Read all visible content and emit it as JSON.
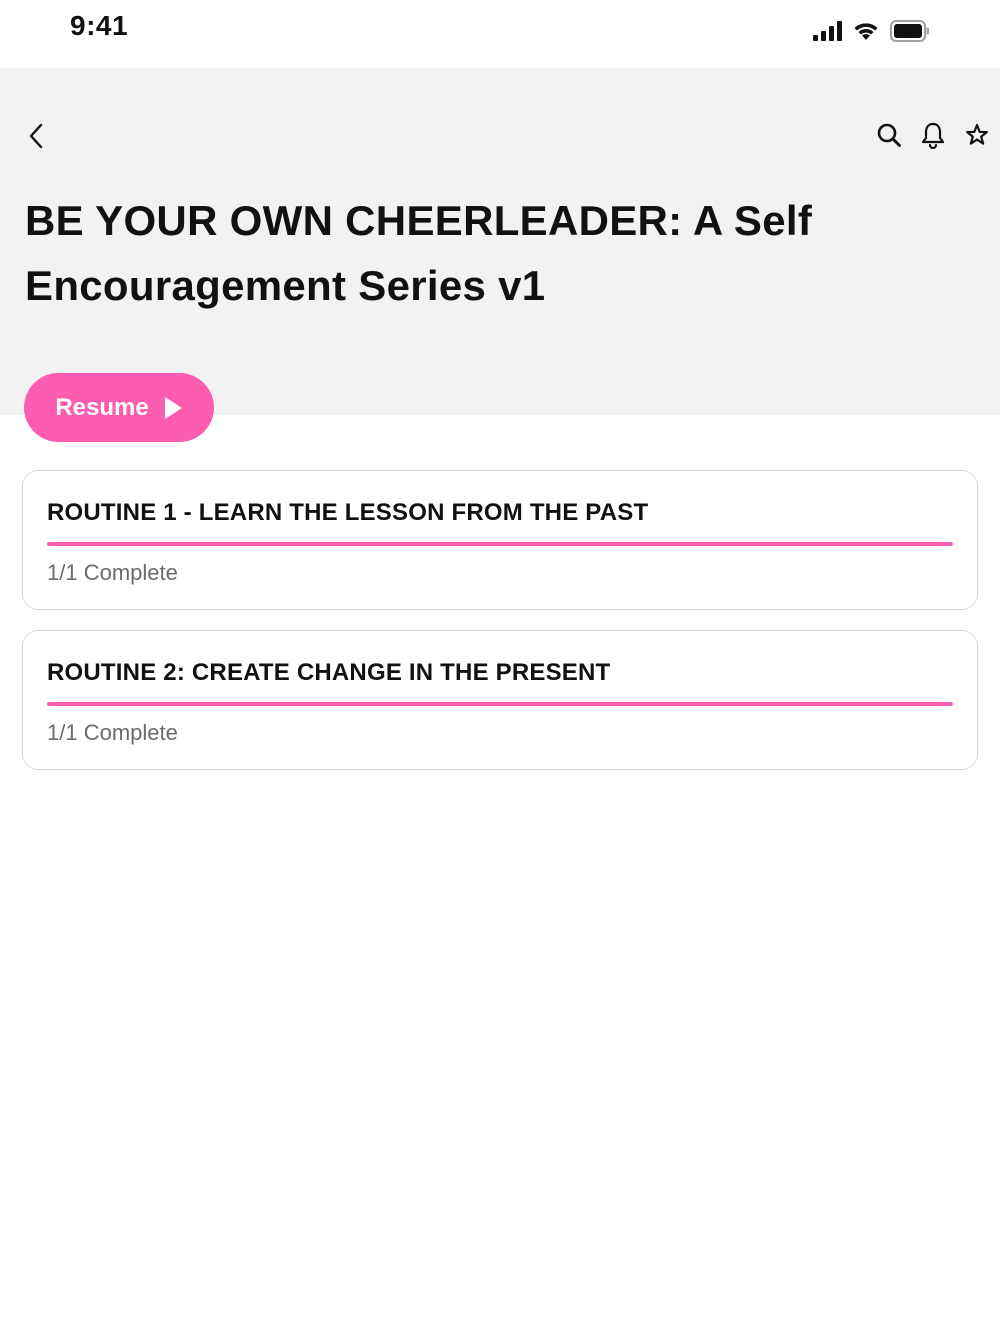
{
  "status_bar": {
    "time": "9:41"
  },
  "header": {
    "title": "BE YOUR OWN CHEERLEADER: A Self Encouragement Series v1",
    "icons": [
      "back-arrow-icon",
      "search-icon",
      "bell-icon",
      "star-icon"
    ]
  },
  "resume": {
    "label": "Resume",
    "icon": "play-icon"
  },
  "routines": [
    {
      "title": "ROUTINE 1 - LEARN THE LESSON FROM THE PAST",
      "status": "1/1 Complete",
      "progress": 1.0
    },
    {
      "title": "ROUTINE 2: CREATE CHANGE IN THE PRESENT",
      "status": "1/1 Complete",
      "progress": 1.0
    }
  ],
  "colors": {
    "accent": "#fd5db0",
    "header_bg": "#f2f2f2",
    "card_border": "#d6d6d6",
    "muted_text": "#6b6b6b"
  }
}
